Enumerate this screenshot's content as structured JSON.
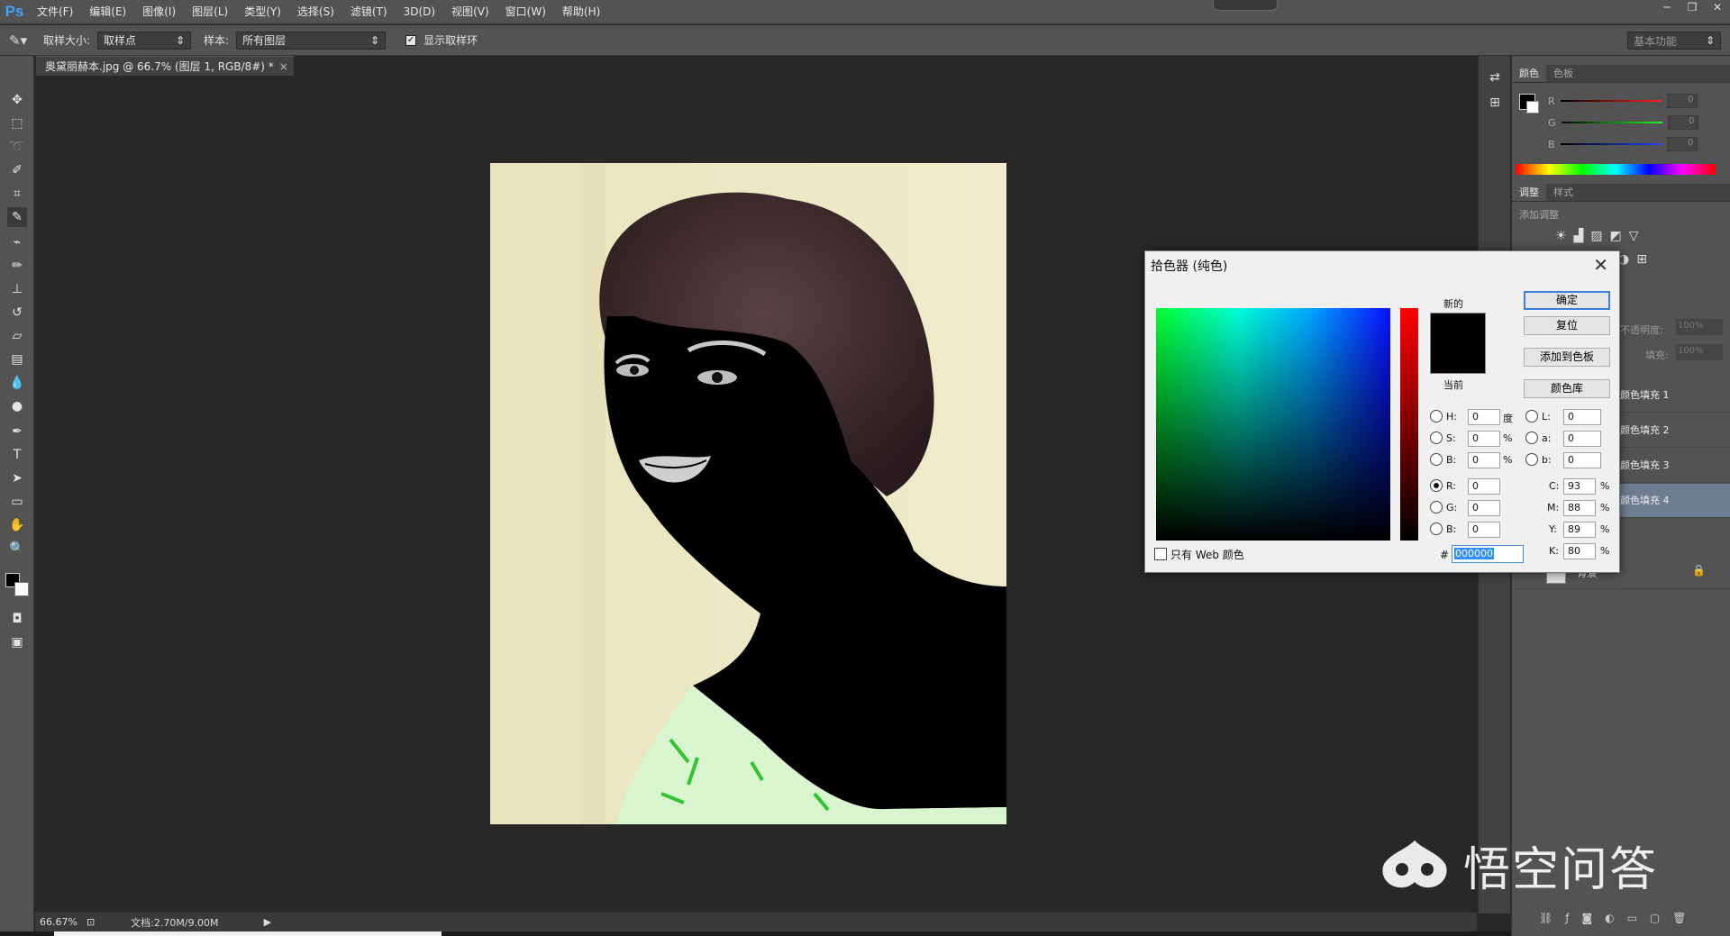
{
  "app": {
    "logo": "Ps",
    "window_buttons": [
      "─",
      "❐",
      "✕"
    ]
  },
  "menu": [
    "文件(F)",
    "编辑(E)",
    "图像(I)",
    "图层(L)",
    "类型(Y)",
    "选择(S)",
    "滤镜(T)",
    "3D(D)",
    "视图(V)",
    "窗口(W)",
    "帮助(H)"
  ],
  "options": {
    "sample_size_label": "取样大小:",
    "sample_size_value": "取样点",
    "sample_label": "样本:",
    "sample_value": "所有图层",
    "show_ring_label": "显示取样环",
    "show_ring_checked": true,
    "workspace": "基本功能"
  },
  "document": {
    "tab_title": "奥黛丽赫本.jpg @ 66.7% (图层 1, RGB/8#) *",
    "close": "×"
  },
  "status": {
    "zoom": "66.67%",
    "doc_size": "文档:2.70M/9.00M"
  },
  "panels": {
    "color_tabs": [
      "颜色",
      "色板"
    ],
    "rgb": [
      {
        "label": "R",
        "value": "0",
        "color": "#e33"
      },
      {
        "label": "G",
        "value": "0",
        "color": "#3c3"
      },
      {
        "label": "B",
        "value": "0",
        "color": "#36f"
      }
    ],
    "adjust_tabs": [
      "调整",
      "样式"
    ],
    "add_adjust": "添加调整",
    "opacity_label": "不透明度:",
    "opacity_value": "100%",
    "fill_label": "填充:",
    "fill_value": "100%",
    "layers": [
      "颜色填充 1",
      "颜色填充 2",
      "颜色填充 3",
      "颜色填充 4"
    ],
    "background_layer": "背景"
  },
  "dialog": {
    "title": "拾色器 (纯色)",
    "new_label": "新的",
    "current_label": "当前",
    "buttons": {
      "ok": "确定",
      "reset": "复位",
      "add_swatch": "添加到色板",
      "libraries": "颜色库"
    },
    "hsb": [
      {
        "label": "H:",
        "value": "0",
        "unit": "度"
      },
      {
        "label": "S:",
        "value": "0",
        "unit": "%"
      },
      {
        "label": "B:",
        "value": "0",
        "unit": "%"
      }
    ],
    "rgb": [
      {
        "label": "R:",
        "value": "0"
      },
      {
        "label": "G:",
        "value": "0"
      },
      {
        "label": "B:",
        "value": "0"
      }
    ],
    "lab": [
      {
        "label": "L:",
        "value": "0"
      },
      {
        "label": "a:",
        "value": "0"
      },
      {
        "label": "b:",
        "value": "0"
      }
    ],
    "cmyk": [
      {
        "label": "C:",
        "value": "93",
        "unit": "%"
      },
      {
        "label": "M:",
        "value": "88",
        "unit": "%"
      },
      {
        "label": "Y:",
        "value": "89",
        "unit": "%"
      },
      {
        "label": "K:",
        "value": "80",
        "unit": "%"
      }
    ],
    "web_only": "只有 Web 颜色",
    "hex_label": "#",
    "hex_value": "000000",
    "selected_color": "#000000"
  },
  "watermark": "悟空问答"
}
